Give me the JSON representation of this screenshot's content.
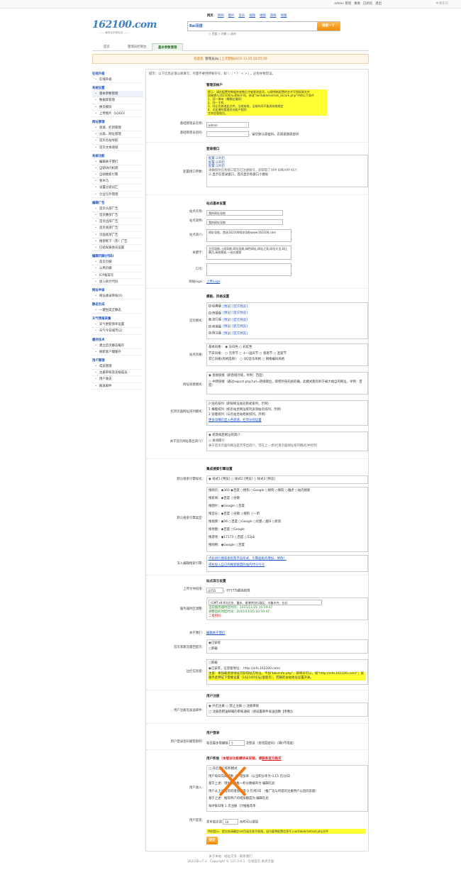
{
  "topbar": {
    "user": "admin",
    "manage": "管理",
    "tuichu": "退出",
    "home": "首页",
    "sitename": "162100.com"
  },
  "topbar_links": {
    "a": "admin 管理",
    "b": "换肤",
    "c": "已阅览",
    "d": "退出",
    "right": "中英车页"
  },
  "logo": {
    "text": "162100.com",
    "sub": "—— 最专业的网址站 ——"
  },
  "search": {
    "tabs": [
      "网页",
      "新闻",
      "图片",
      "音乐",
      "视频",
      "地图",
      "游戏",
      "地图"
    ],
    "engine": "Bai百度",
    "button": "搜索一下",
    "options": "○ 百度 ○ 谷歌 ○ 站内"
  },
  "navtabs": {
    "t1": "首页",
    "t2": "管理员控制台",
    "t3": "基本参数管理"
  },
  "welcome": {
    "text": "欢迎您,",
    "user": "管理员jtq",
    "last": "| 上次登陆2015-11-25 10:55:56"
  },
  "sidebar": {
    "sections": [
      {
        "title": "在线升级",
        "items": [
          "在线升级"
        ]
      },
      {
        "title": "系统设置",
        "items": [
          "基本参数管理",
          "数据库管理",
          "换页模块",
          "上传图片（LOGO）"
        ]
      },
      {
        "title": "网址管理",
        "items": [
          "频道、栏目管理",
          "分类、网址管理",
          "首页名站导航",
          "首页文本链接"
        ]
      },
      {
        "title": "系统功能",
        "items": [
          "编辑关于我们",
          "自助访问机理",
          "自助搜索引擎",
          "查木马",
          "设置过滤词汇",
          "企业号外管理"
        ]
      },
      {
        "title": "编辑广告",
        "items": [
          "首页头部广告",
          "首页腰部广告",
          "首页边部广告",
          "首页底部广告",
          "页面底部广告",
          "搜索框下（旁）广告",
          "已站发展会员设置"
        ]
      },
      {
        "title": "编辑页脚(代码)",
        "items": [
          "首页页脚",
          "公用页脚",
          "ICP备案号",
          "加入统计代码"
        ]
      },
      {
        "title": "网址申录",
        "items": [
          "网址收录审核(0)"
        ]
      },
      {
        "title": "静态生成",
        "items": [
          "一键生成全静态"
        ]
      },
      {
        "title": "天气预报采集",
        "items": [
          "天气更新频率设置",
          "天气今日城市(2)"
        ]
      },
      {
        "title": "缓存技术",
        "items": [
          "建立首页静态缓存",
          "刷新客户端缓存"
        ]
      },
      {
        "title": "用户管理",
        "items": [
          "成员管理",
          "注册审核及违规成员",
          "用户收支",
          "群发邮件"
        ]
      }
    ]
  },
  "tip": "提示：以下信息必须认真填写，尽量不要用特殊符号，如 \\ : ; * ? ' < > | 。必免导致错误。",
  "admin": {
    "section": "管理员帐户",
    "note": "提示：请在配置完数据库参数后才能更改此项，以便将新配置的名字写到权限文件\n如果想与162100mu密码不同，修改\"/writable/set/set_secure.php\"中的以下条件\n1、同一城市（模糊达域网）\n2、同一主机\n3、同正在修改此文件，当地系统，当前时间不能改系统规定\n4、近此增的管理员名帐户相同\n言则会管理员。",
    "name_label": "基础管理员名称:",
    "name_value": "admin",
    "pwd_label": "基础管理员密码:",
    "pwd_note": "，留空默认原密码。否则更换原密码"
  },
  "login": {
    "section": "登录接口",
    "label": "配置接口参数:",
    "rows": [
      "配置 ☑开启",
      "配置 ☑开启",
      "配置 ☑开启"
    ],
    "note": "请确保你在各接口官方已注册账号，即获取了APP ID和APP KEY",
    "check": "☑ 显示在登录窗口，首页显示各接口小图标"
  },
  "site": {
    "section": "站点基本设置",
    "name_label": "站点名称:",
    "name_value": "我的网址导航",
    "alias_label": "站点简称:",
    "alias_value": "我的网址导航",
    "intro_label": "站点简介:",
    "intro_value": "网址导航，首选162100网址导航www.162100.com",
    "kw_label": "关键字:",
    "kw_value": "主页导航,上网导航,网址导航,绿色网址,网址之家,网址大全,网上黄页,高效搜索,一站式搜索",
    "desc_label": "口号:",
    "logo_label": "网站logo:",
    "logo_link": "上传Logo"
  },
  "tpl": {
    "section": "模板、风格设置",
    "mode_label": "首页模式:",
    "modes": [
      "经典版",
      "快捷版",
      "流行版",
      "商城版",
      "简洁版"
    ],
    "mode_on": 2,
    "mode_preview": "[预览] [官方预览]",
    "style_label": "站点风格:",
    "style_rows": [
      "基本风格： ◉ 灰白色 ○ 彩虹色",
      "节日风格： ○ 元宵节 ○ 十一国庆节 ○ 感恩节 ○ 圣诞节",
      "其它风格(风格选择)： ○ QQ音乐风格 ○ 网络编码风格"
    ],
    "link_label": "网址链接模式:",
    "link_opts": [
      "◉ 直接链接（即直接外链，举例：百度）",
      "○ 中转链接（通过export.php?url=链接跳出，即把外链先统的确，此模式能有利于被大幅自的网址，举例：百度）"
    ],
    "col_label": "栏目页面网址排列模式:",
    "col_opts": [
      "0 站名排列（即按网址站名称式排列，示例）",
      "1 横着排列（如名站坐网址排列多添站名排列，示例）",
      "2 竖着排列（与名站坐站相关排列，示例）"
    ],
    "col_link": "更多详细页显入各频道、栏目分别设置",
    "about_label": "关于首页网址簇出简介?",
    "about_opts": [
      "◉ 修改阅后网址的简介",
      "○ 关闭简介"
    ],
    "about_note": "关于首页页面的网址是否带出简介，可在上一步[栏目页面网址排列模式]中控制"
  },
  "se": {
    "section": "集成搜索引擎设置",
    "def_label": "默认搜索引擎样式:",
    "def_opts": "◉ 样式1 [预览] ○ 样式2 [预览] ○ 样式3 [预览]",
    "types_label": "默认搜索引擎类型:",
    "types": [
      "搜网页：◉360 ◉百度 ○搜狗 ○Google ○搜狗 ○微软 ○雅虎 ○站内搜索",
      "搜新闻：◉百度 ○谷歌",
      "搜图片：◉Google ○百度",
      "搜音乐：◉百度 ○谷歌 ○搜狗 ○一听",
      "搜视频：◉56 ○百度 ○Google ○优酷 ○酷6 ○新浪",
      "搜地图：◉百度 ○Google",
      "搜游戏：◉17173 ○百度 ○52pk",
      "搜购物：◉Google ○百度"
    ],
    "deep_label": "深入编辑搜索引擎:",
    "deep_links": [
      "点此进行搜索类别及字段形式、引擎面板的增加、修改！",
      "或拉加入自己的搜索联盟的站内代号引号"
    ]
  },
  "other": {
    "section": "站点其它设置",
    "upload_label": "上传文件权限:",
    "upload_value": "0755",
    "upload_note": "，0777为最高权限",
    "tz_label": "服务器时区调整:",
    "tz_value": "(GMT+8:00)北京、重庆、香港特别行政区、乌鲁木齐、台北",
    "tz_line1": "当前服务器时区时间：2015/11/25 10:59:47",
    "tz_line2": "调整后的时区时间：2015/11/25 10:59:47",
    "tz_line3": "二者相同",
    "about_label": "关于我们:",
    "about_link": "编辑关于我们",
    "traffic_label": "首页来路流量西提示:",
    "traffic_opts": [
      "◉已安装",
      "○卸载"
    ],
    "side_label": "边栏信息窗:",
    "side_opts": [
      "○卸载",
      "◉已安装，信息窗地址： http://info.162100.com/"
    ],
    "side_note": "注意：将加载直接地址可获得站方地址，不加\"bbs/info.php\"，即将对可以，如\"http://info.162100.com/\"，就服务此特征下需要设置（162100论坛/盗版页），若删的访站地址设置开关。"
  },
  "reg": {
    "section": "用户注册",
    "label": "用户注册及发送邮件:",
    "opts": "◉ 开启注册 ○ 禁止注册 ○ 注册审核",
    "check": "□ 注册后把送邮箱的审核通知（请设置邮件发送函数【参数】）",
    "check_link": "请设置邮件发送函数【参数】"
  },
  "loginset": {
    "section": "用户登录",
    "label": "用户登录密码输错限制:",
    "text1": "每日最多限输错",
    "value": "5",
    "text2": "次登录（含找回密码）（填0不限定）"
  },
  "income": {
    "section": "用户积收",
    "sub": "（本版访功能模块未安装，请",
    "sub_link": "联系官方购买",
    "label": "用户收入:",
    "rows": [
      "□ 开启用户积积模式",
      "用户每日向阅读数（一增加率（以当积分率为 0.15 元/分日",
      "基于上述：增加用户推一积分数据率为 编辑在此",
      "用户从上述推荐的增加额度 0 元/积/日 （推广功与所提的注册用户以后的答题）",
      "基于上述：推荐用户的增加额度为 编辑在此",
      "每IP每日限 1 次注册（计推推荐率"
    ]
  },
  "cash": {
    "label": "用户提现:",
    "text1": "货币值达到",
    "value": "10",
    "text2": "元时可以提现"
  },
  "final_note": "特别提示：提交前请确定set目录及各写权限，因为要将配置信息写入writable/set/set.php文件",
  "submit": "提交",
  "footer": {
    "links": "关于本站 · 站址交流 · 联系我们",
    "power": "Powered by 162100网址导航 2015 · 北京时间 127.0.0.1 · 加载首页 关闭页面",
    "copy": "162100 v7.3 · Copyright © 127.0.0.1 · 在线首页 关闭页面"
  }
}
